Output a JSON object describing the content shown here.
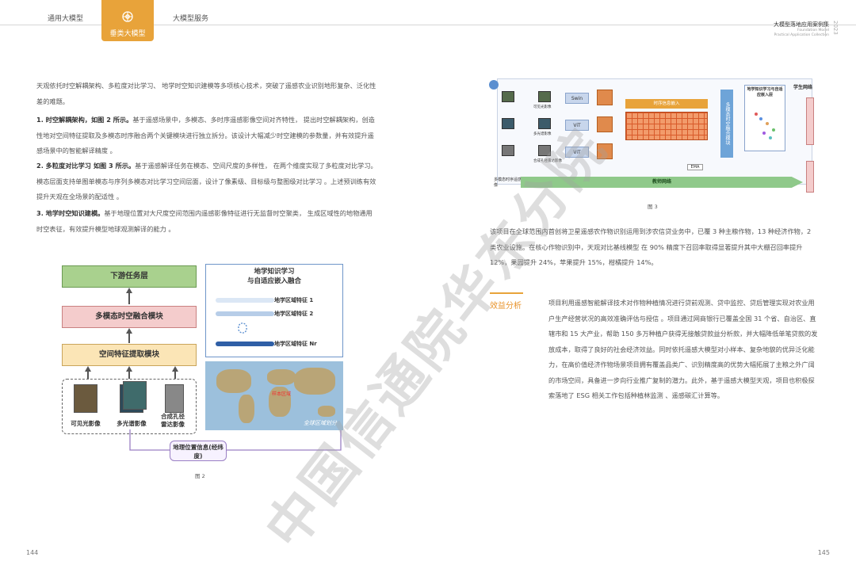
{
  "header": {
    "tabs": [
      "通用大模型",
      "垂类大模型",
      "大模型服务"
    ],
    "active_tab": "垂类大模型",
    "right_title": "大模型落地应用案例集",
    "right_subtitle_1": "Foundation Model",
    "right_subtitle_2": "Practical Application Collection",
    "year": "2023"
  },
  "left": {
    "intro": "天观依托时空解耦架构、多粒度对比学习、 地学时空知识建模等多项核心技术，突破了遥感农业识别地形复杂、泛化性差的难题。",
    "p1_bold": "1. 时空解耦架构，如图 2 所示。",
    "p1_text": "基于遥感场景中，多模态、多时序遥感影像空间对齐特性， 提出时空解耦架构，创造性地对空间特征提取及多模态时序融合两个关键模块进行独立拆分。该设计大幅减少时空建模的参数量，并有效提升遥感场景中的智能解译精度 。",
    "p2_bold": "2. 多粒度对比学习 如图 3 所示。",
    "p2_text": "基于遥感解译任务在模态、空间尺度的多样性， 在两个维度实现了多粒度对比学习。模态层面支持单图单模态与序列多模态对比学习空间层面，设计了像素级、目标级与整图级对比学习 。上述预训练有效提升天观在全场景的配适性 。",
    "p3_bold": "3. 地学时空知识建模。",
    "p3_text": "基于地理位置对大尺度空间范围内遥感影像特征进行无监督时空聚类， 生成区域性的地物通用时空表征，有效提升模型地球观测解译的能力 。"
  },
  "fig2": {
    "boxes": [
      "下游任务层",
      "多模态时空融合模块",
      "空间特征提取模块"
    ],
    "images": [
      "可见光影像",
      "多光谱影像",
      "合成孔径雷达影像"
    ],
    "geo": "地理位置信息(经纬度)",
    "panel_title_1": "地学知识学习",
    "panel_title_2": "与自适应嵌入融合",
    "features": [
      "地学区域特征 1",
      "地学区域特征 2",
      "地学区域特征 Nr"
    ],
    "map_caption": "全球区域划分",
    "map_label": "样本区域",
    "caption": "图 2"
  },
  "fig3": {
    "modules": [
      "Swin",
      "ViT",
      "ViT"
    ],
    "sequence_label": "时序信息嵌入",
    "fusion_label": "多模态时空融合模块",
    "right_box": "地学知识学习与自适应嵌入层",
    "student": "学生网络",
    "teacher": "教师网络",
    "ema": "EMA",
    "input_label": "多模态时序遥感影像",
    "thumb_labels": [
      "可见光影像",
      "多光谱影像",
      "合成孔径雷达影像"
    ],
    "caption": "图 3"
  },
  "right": {
    "p1": "该项目在全球范围内首创将卫星遥感农作物识别运用到涉农信贷业务中，已覆 3 种主粮作物，13 种经济作物，2 类农业设施。在核心作物识别中，天观对比基线模型 在 90% 精度下召回率取得显著提升其中大棚召回率提升 12%，果园提升 24%，苹果提升 15%，柑橘提升 14%。",
    "section_title": "效益分析",
    "p2": "项目利用遥感智能解译技术对作物种植情况进行贷前观测、贷中监控、贷后管理实现对农业用户生产经营状况的高效准确评估与授信 。项目通过网商银行已覆盖全国 31 个省、自治区、直辖市和 15 大产业，帮助 150 多万种植户获得无接触贷款益分析款，并大幅降低单笔贷款的发放成本，取得了良好的社会经济效益。同时依托遥感大模型对小样本、复杂地貌的优异泛化能力，在高价值经济作物场景项目拥有覆盖品类广、识别精度高的优势大幅拓展了主粮之外广阔的市场空间，具备进一步向行业推广复制的潜力。此外，基于遥感大模型天观，项目也积极探索落地了 ESG 相关工作包括种植林监测 、遥感碳汇计算等。"
  },
  "pages": {
    "left": "144",
    "right": "145"
  },
  "watermark": "中国信通院华东分院",
  "colors": {
    "accent": "#e8a33a",
    "downstream": "#a9d18e",
    "fusion": "#f4cccc",
    "spatial": "#fbe5b6"
  }
}
